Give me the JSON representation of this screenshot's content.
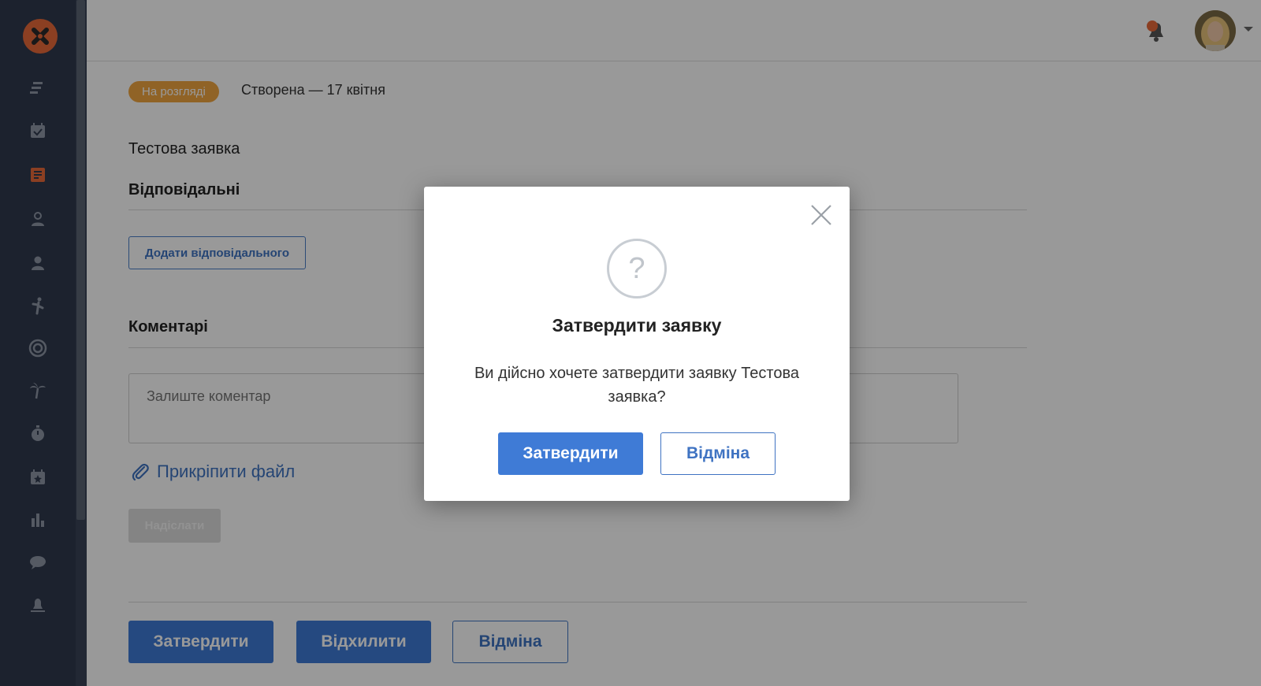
{
  "colors": {
    "sidebar_bg": "#2f3a4e",
    "accent": "#e8693a",
    "primary": "#3f7bd6",
    "status_badge": "#f0a640"
  },
  "sidebar": {
    "logo": "x-logo-icon",
    "items": [
      {
        "icon": "feed-icon"
      },
      {
        "icon": "calendar-check-icon"
      },
      {
        "icon": "requests-icon",
        "active": true
      },
      {
        "icon": "user-outline-icon"
      },
      {
        "icon": "user-icon"
      },
      {
        "icon": "figure-icon"
      },
      {
        "icon": "target-icon"
      },
      {
        "icon": "palm-tree-icon"
      },
      {
        "icon": "stopwatch-icon"
      },
      {
        "icon": "calendar-star-icon"
      },
      {
        "icon": "bar-chart-icon"
      },
      {
        "icon": "chat-icon"
      },
      {
        "icon": "bell-off-icon"
      }
    ]
  },
  "header": {
    "notification_icon": "notification-bell-icon",
    "avatar_icon": "user-avatar"
  },
  "request": {
    "status": "На розгляді",
    "created": "Створена — 17 квітня",
    "title": "Тестова заявка",
    "responsible_title": "Відповідальні",
    "add_responsible": "Додати відповідального",
    "comments_title": "Коментарі",
    "comment_placeholder": "Залиште коментар",
    "attach_file": "Прикріпити файл",
    "send": "Надіслати",
    "approve": "Затвердити",
    "reject": "Відхилити",
    "cancel": "Відміна"
  },
  "modal": {
    "title": "Затвердити заявку",
    "text": "Ви дійсно хочете затвердити заявку Тестова заявка?",
    "confirm": "Затвердити",
    "cancel": "Відміна"
  }
}
